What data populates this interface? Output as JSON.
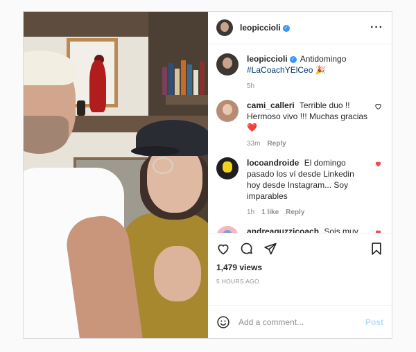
{
  "header": {
    "username": "leopiccioli",
    "verified_icon": "verified-badge-icon",
    "more_icon": "more-options-icon"
  },
  "caption": {
    "username": "leopiccioli",
    "text": "Antidomingo",
    "hashtag": "#LaCoachYElCeo",
    "emoji": "🎉",
    "time": "5h"
  },
  "comments": [
    {
      "username": "cami_calleri",
      "text": "Terrible duo !! Hermoso vivo !!! Muchas gracias ❤️",
      "time": "33m",
      "likes": "",
      "reply": "Reply",
      "liked": false
    },
    {
      "username": "locoandroide",
      "text": "El domingo pasado los ví desde Linkedin hoy desde Instagram... Soy imparables",
      "time": "1h",
      "likes": "1 like",
      "reply": "Reply",
      "liked": true
    },
    {
      "username": "andreaguzzicoach",
      "text": "Sois muy súper top! 👏👏👏🙌🙌🙌",
      "time": "",
      "likes": "",
      "reply": "",
      "liked": true
    }
  ],
  "stats": {
    "views": "1,479 views",
    "timestamp": "5 HOURS AGO"
  },
  "add_comment": {
    "placeholder": "Add a comment...",
    "post_label": "Post"
  },
  "colors": {
    "liked_heart": "#ed4956",
    "link": "#00376b",
    "verified": "#3897f0",
    "post_disabled": "#b2dffc"
  }
}
